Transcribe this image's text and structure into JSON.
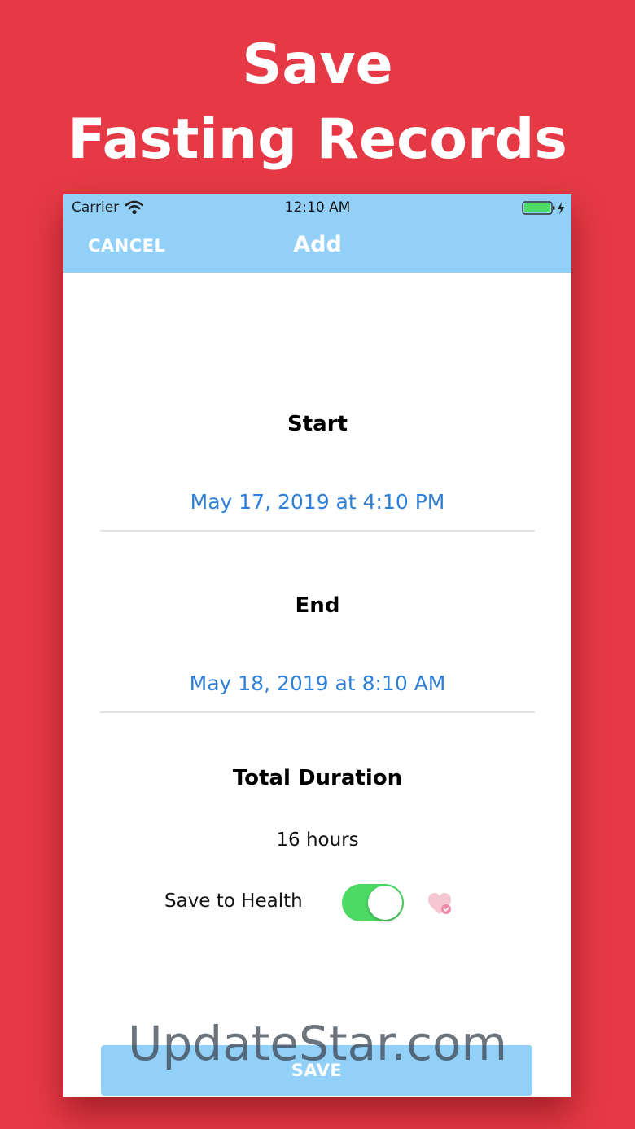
{
  "promo": {
    "line1": "Save",
    "line2": "Fasting Records"
  },
  "status_bar": {
    "carrier": "Carrier",
    "time": "12:10 AM"
  },
  "navbar": {
    "cancel_label": "CANCEL",
    "title": "Add"
  },
  "form": {
    "start_label": "Start",
    "start_value": "May 17, 2019 at 4:10 PM",
    "end_label": "End",
    "end_value": "May 18, 2019 at 8:10 AM",
    "duration_label": "Total Duration",
    "duration_value": "16 hours",
    "health_label": "Save to Health",
    "health_toggle_on": true
  },
  "save_label": "SAVE",
  "watermark": "UpdateStar.com",
  "colors": {
    "background": "#e63946",
    "navbar": "#93d0f8",
    "date_text": "#2f7fd6",
    "toggle_on": "#4cd964"
  }
}
